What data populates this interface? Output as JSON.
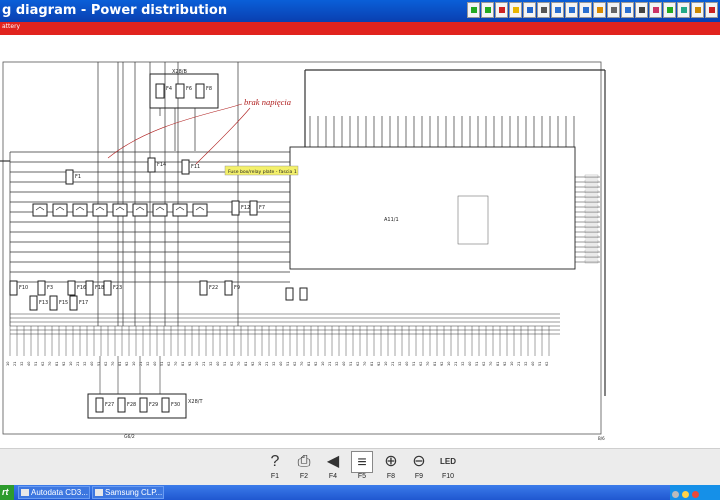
{
  "window": {
    "title": "g diagram - Power distribution",
    "toolbar_icons": [
      "back-icon",
      "forward-icon",
      "stop-icon",
      "warning-icon",
      "home-icon",
      "print-icon",
      "search-icon",
      "zoom-icon",
      "help-icon",
      "bookmark-icon",
      "settings-icon",
      "info-icon",
      "list-icon",
      "user-icon",
      "grid-icon",
      "refresh-icon",
      "mail-icon",
      "close-icon"
    ]
  },
  "redbar": {
    "label": "attery"
  },
  "diagram": {
    "annotation": "brak napięcia",
    "tooltip": "Fuse box/relay plate - fascia 1",
    "connector_top": "X28/B",
    "connector_bottom": "X28/T",
    "module_label": "A11/1",
    "relays_top": [
      "F4",
      "F6",
      "F8"
    ],
    "fuses_mid": [
      "F1",
      "F14",
      "F11",
      "F12",
      "F7"
    ],
    "fuses_bottom": [
      "F10",
      "F3",
      "F16",
      "F18",
      "F23",
      "F22",
      "F9"
    ],
    "fuses_left": [
      "F13",
      "F15",
      "F17"
    ],
    "fuses_lower": [
      "F27",
      "F28",
      "F29",
      "F30"
    ],
    "colors": {
      "titlebar": "#0a4fc8",
      "redbar": "#e1231e",
      "wire": "#333333",
      "annotation": "#b02020",
      "tooltip": "#f3f06a"
    },
    "corner_label_bottom": "G6/2",
    "corner_label_right": "B/6"
  },
  "fkeys": [
    {
      "key": "F1",
      "icon": "help-icon",
      "glyph": "?"
    },
    {
      "key": "F2",
      "icon": "print-icon",
      "glyph": "⎙"
    },
    {
      "key": "F4",
      "icon": "back-icon",
      "glyph": "◀"
    },
    {
      "key": "F5",
      "icon": "wiring-icon",
      "glyph": "≡"
    },
    {
      "key": "F8",
      "icon": "zoom-in-icon",
      "glyph": "⊕"
    },
    {
      "key": "F9",
      "icon": "zoom-out-icon",
      "glyph": "⊖"
    },
    {
      "key": "F10",
      "icon": "led-pass-icon",
      "glyph": "LED"
    }
  ],
  "taskbar": {
    "start": "rt",
    "tasks": [
      {
        "label": "Autodata CD3..."
      },
      {
        "label": "Samsung CLP..."
      }
    ]
  }
}
